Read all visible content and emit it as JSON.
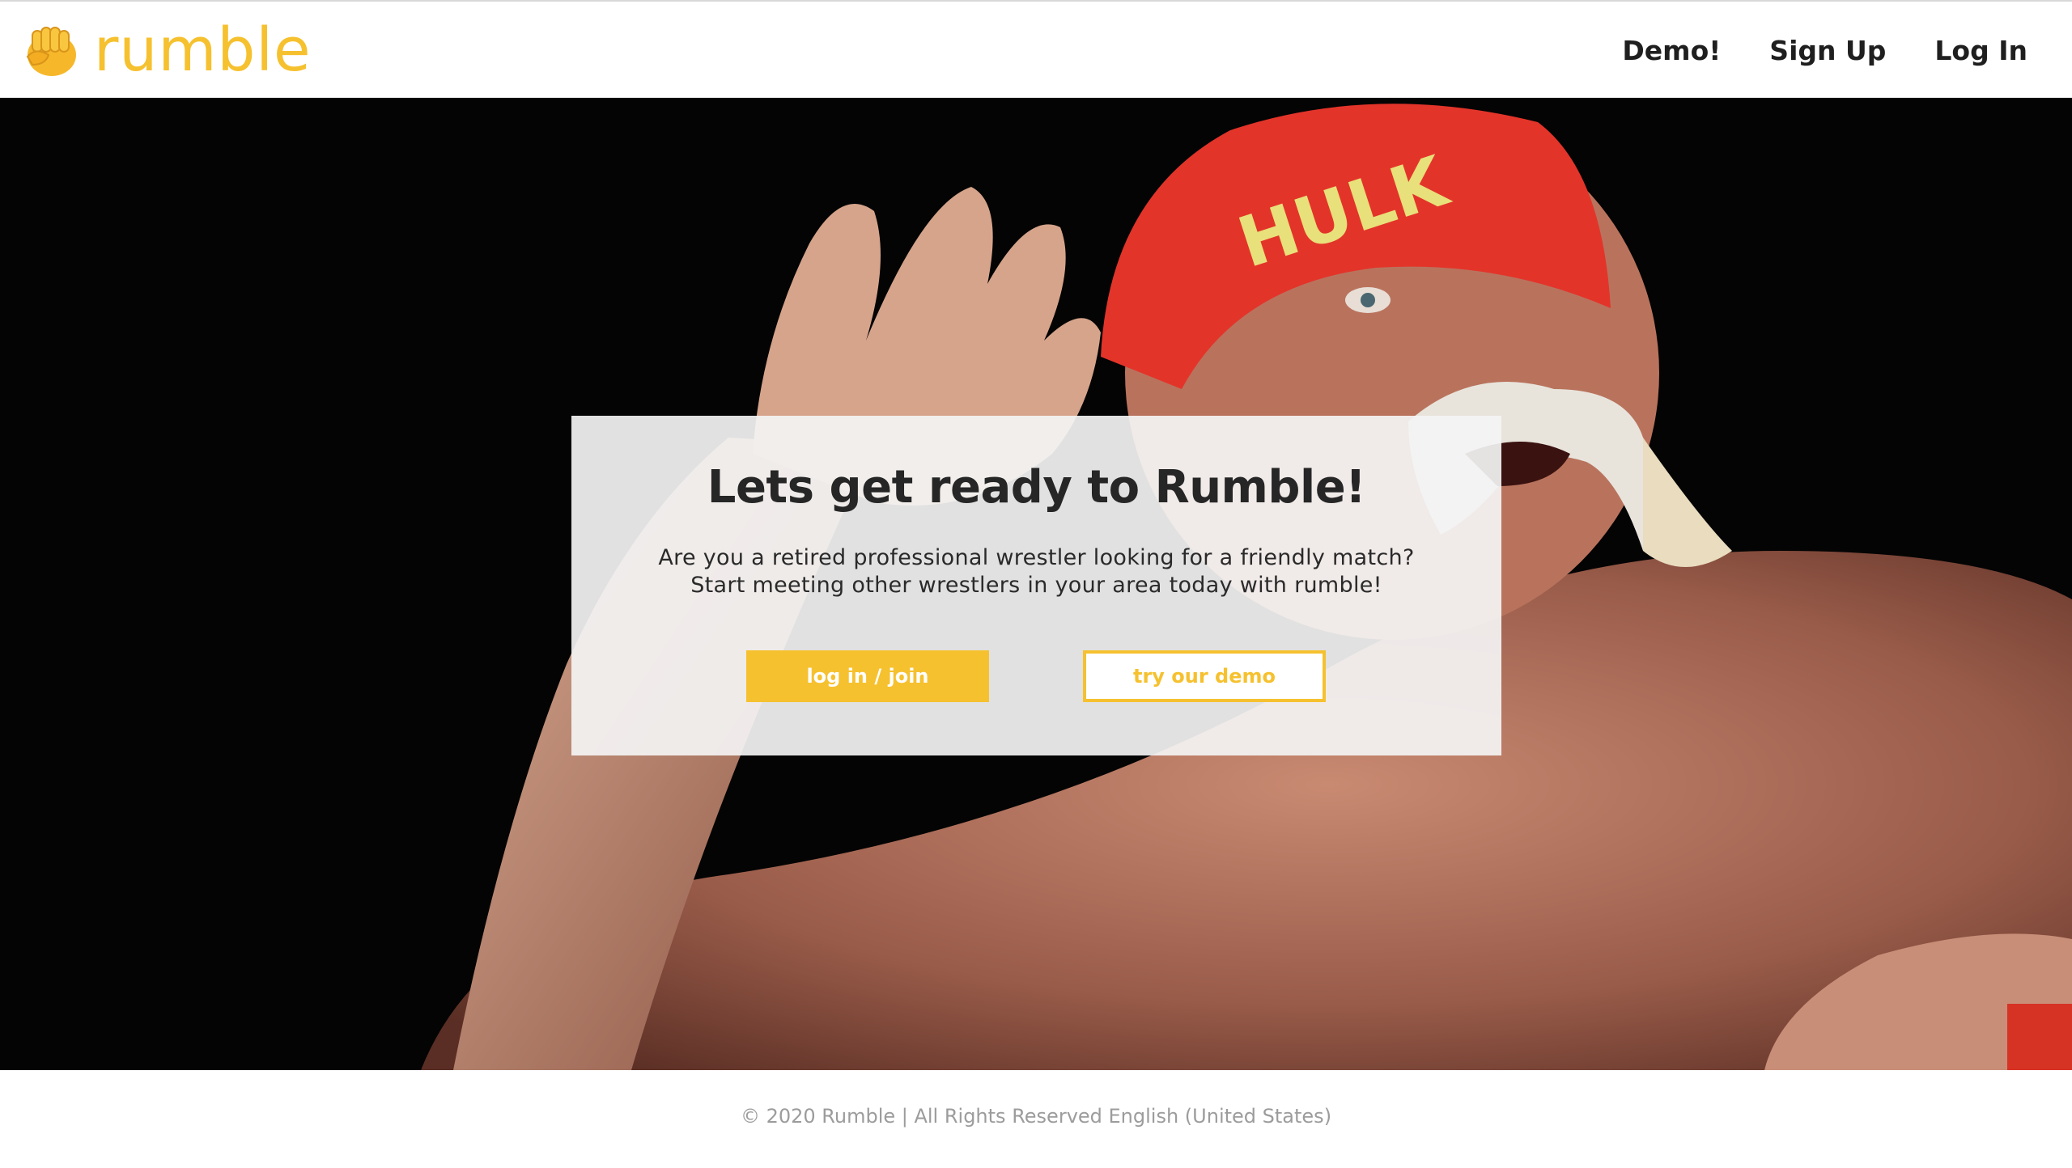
{
  "header": {
    "logo_text": "rumble",
    "logo_icon": "fist-icon",
    "nav": [
      {
        "label": "Demo!"
      },
      {
        "label": "Sign Up"
      },
      {
        "label": "Log In"
      }
    ]
  },
  "hero": {
    "title": "Lets get ready to Rumble!",
    "description_line1": "Are you a retired professional wrestler looking for a friendly match?",
    "description_line2": "Start meeting other wrestlers in your area today with rumble!",
    "primary_button": "log in / join",
    "secondary_button": "try our demo"
  },
  "footer": {
    "text": "© 2020 Rumble | All Rights Reserved English (United States)"
  },
  "colors": {
    "accent": "#f6c12f",
    "text": "#262626",
    "footer_text": "#9c9c9c"
  }
}
